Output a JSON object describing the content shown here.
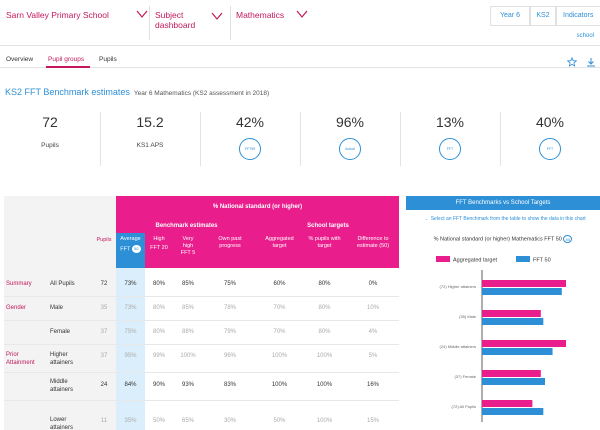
{
  "header": {
    "school": "Sarn Valley Primary School",
    "subject_line1": "Subject",
    "subject_line2": "dashboard",
    "subject": "Mathematics",
    "year": "Year 6",
    "ks": "KS2",
    "indicators": "Indicators",
    "school_link": "school"
  },
  "tabs": [
    "Overview",
    "Pupil groups",
    "Pupils"
  ],
  "title": {
    "main": "KS2 FFT Benchmark estimates",
    "sub": "Year 6 Mathematics (KS2 assessment in 2018)"
  },
  "stats": [
    {
      "value": "72",
      "label": "Pupils"
    },
    {
      "value": "15.2",
      "label": "KS1 APS"
    },
    {
      "value": "42%",
      "badge": "FFT99"
    },
    {
      "value": "96%",
      "badge": "Actual"
    },
    {
      "value": "13%",
      "badge": "FFT"
    },
    {
      "value": "40%",
      "badge": "FFT"
    }
  ],
  "table": {
    "top_header": "% National standard (or higher)",
    "group_benchmark": "Benchmark estimates",
    "group_targets": "School targets",
    "col_pupils": "Pupils",
    "cols": [
      {
        "l1": "Average",
        "l2": "FFT",
        "pill": "50"
      },
      {
        "l1": "High",
        "l2": "FFT 20"
      },
      {
        "l1": "Very",
        "l2": "high",
        "l3": "FFT 5"
      },
      {
        "l1": "Own past",
        "l2": "progress"
      },
      {
        "l1": "Aggregated",
        "l2": "target"
      },
      {
        "l1": "% pupils with",
        "l2": "target"
      },
      {
        "l1": "Difference to",
        "l2": "estimate (50)"
      }
    ],
    "rows": [
      {
        "group": "Summary",
        "sub": "All Pupils",
        "pupils": "72",
        "vals": [
          "73%",
          "80%",
          "85%",
          "75%",
          "60%",
          "80%",
          "0%"
        ]
      },
      {
        "group": "Gender",
        "sub": "Male",
        "pupils": "35",
        "vals": [
          "73%",
          "80%",
          "85%",
          "78%",
          "70%",
          "80%",
          "10%"
        ]
      },
      {
        "group": "",
        "sub": "Female",
        "pupils": "37",
        "vals": [
          "75%",
          "80%",
          "88%",
          "79%",
          "70%",
          "80%",
          "4%"
        ]
      },
      {
        "group": "Prior Attainment",
        "sub": "Higher attainers",
        "pupils": "37",
        "vals": [
          "95%",
          "99%",
          "100%",
          "96%",
          "100%",
          "100%",
          "5%"
        ]
      },
      {
        "group": "",
        "sub": "Middle attainers",
        "pupils": "24",
        "vals": [
          "84%",
          "90%",
          "93%",
          "83%",
          "100%",
          "100%",
          "16%"
        ]
      },
      {
        "group": "",
        "sub": "Lower attainers",
        "pupils": "11",
        "vals": [
          "35%",
          "50%",
          "65%",
          "30%",
          "50%",
          "100%",
          "15%"
        ]
      }
    ]
  },
  "chart_panel": {
    "header": "FFT Benchmarks vs School Targets",
    "note": "← Select an FFT Benchmark from the table to show the data in this chart",
    "subtitle": "% National standard (or higher) Mathematics FFT 50",
    "subtitle_pill": "50"
  },
  "chart_data": {
    "type": "bar",
    "orientation": "horizontal",
    "categories": [
      "(72) Higher attainers",
      "(35) Male",
      "(24) Middle attainers",
      "(37) Female",
      "(72) All Pupils"
    ],
    "series": [
      {
        "name": "Aggregated target",
        "color": "#e91e8c",
        "values": [
          100,
          70,
          100,
          70,
          60
        ]
      },
      {
        "name": "FFT 50",
        "color": "#2d8fd6",
        "values": [
          95,
          73,
          84,
          75,
          73
        ]
      }
    ],
    "xlim": [
      0,
      100
    ]
  },
  "colors": {
    "pink": "#e91e8c",
    "blue": "#2d8fd6",
    "crimson": "#c2185b"
  }
}
